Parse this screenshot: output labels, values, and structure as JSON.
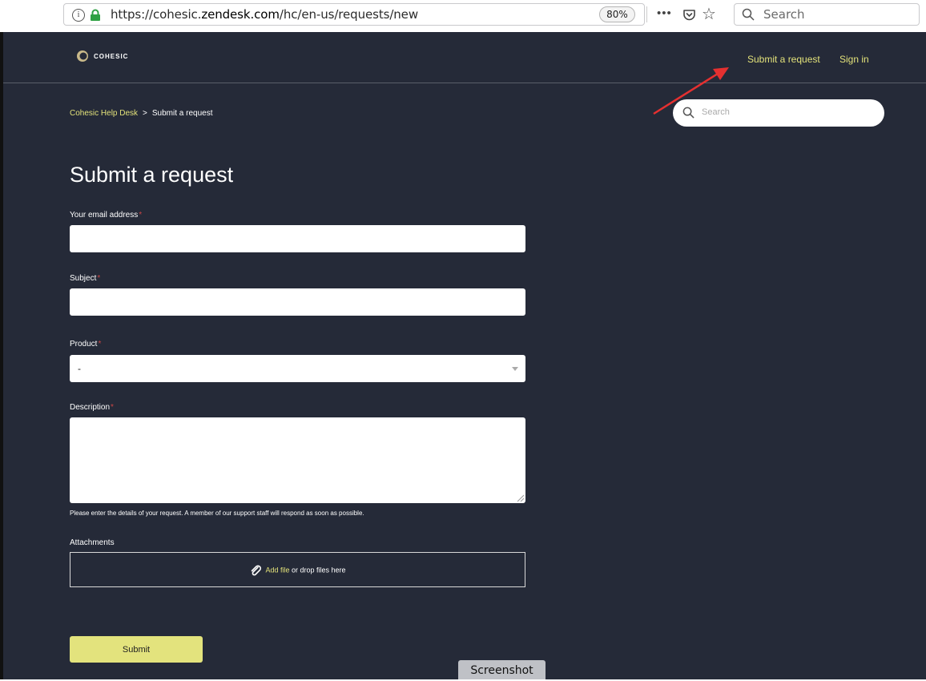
{
  "browser": {
    "url_prefix": "https://cohesic.",
    "url_domain": "zendesk.com",
    "url_path": "/hc/en-us/requests/new",
    "zoom": "80%",
    "search_placeholder": "Search"
  },
  "header": {
    "logo_text": "COHESIC",
    "nav": {
      "submit_request": "Submit a request",
      "sign_in": "Sign in"
    }
  },
  "breadcrumb": {
    "home": "Cohesic Help Desk",
    "separator": ">",
    "current": "Submit a request"
  },
  "hc_search": {
    "placeholder": "Search"
  },
  "form": {
    "title": "Submit a request",
    "email_label": "Your email address",
    "subject_label": "Subject",
    "product_label": "Product",
    "product_value": "-",
    "description_label": "Description",
    "required_mark": "*",
    "description_hint": "Please enter the details of your request. A member of our support staff will respond as soon as possible.",
    "attachments_label": "Attachments",
    "add_file": "Add file",
    "drop_text": " or drop files here",
    "submit": "Submit"
  },
  "overlay": {
    "screenshot_tab": "Screenshot"
  },
  "colors": {
    "accent": "#e3e27a",
    "background": "#252a38",
    "annotation_arrow": "#e53030"
  },
  "icons": [
    "info-icon",
    "lock-icon",
    "more-icon",
    "pocket-icon",
    "star-icon",
    "search-icon",
    "logo-mark-icon",
    "paperclip-icon",
    "chevron-down-icon"
  ]
}
